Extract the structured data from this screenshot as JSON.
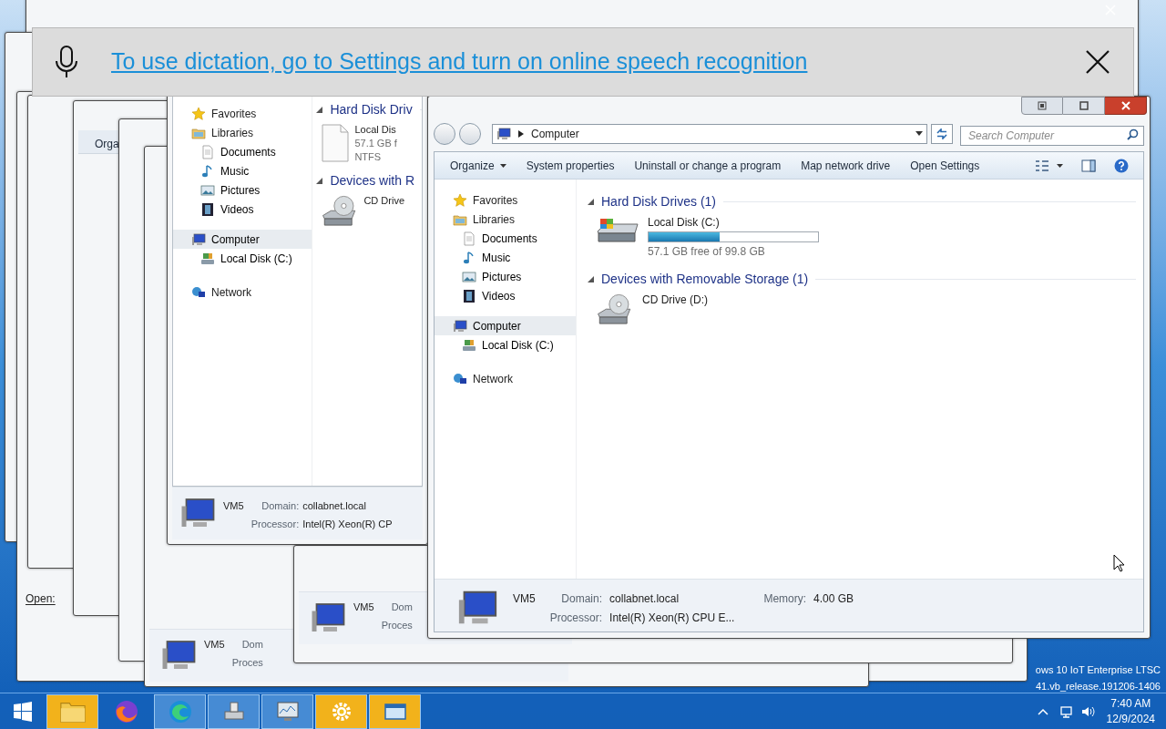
{
  "banner": {
    "message": "To use dictation, go to Settings and turn on online speech recognition"
  },
  "background_windows": {
    "toolbar_fragment": "Orga",
    "open_label": "Open:",
    "footers": [
      {
        "computer": "VM5",
        "field_1": "Dom",
        "field_2": "Proces"
      },
      {
        "computer": "VM5",
        "field_1": "Dom",
        "field_2": "Proces"
      }
    ]
  },
  "back_explorer": {
    "nav": [
      {
        "kind": "star",
        "label": "Favorites",
        "selected": false
      },
      {
        "kind": "library",
        "label": "Libraries",
        "selected": false,
        "children": [
          {
            "kind": "document",
            "label": "Documents",
            "selected": false
          },
          {
            "kind": "music",
            "label": "Music",
            "selected": false
          },
          {
            "kind": "picture",
            "label": "Pictures",
            "selected": false
          },
          {
            "kind": "video",
            "label": "Videos",
            "selected": false
          }
        ]
      },
      {
        "kind": "computer",
        "label": "Computer",
        "selected": true,
        "children": [
          {
            "kind": "disk",
            "label": "Local Disk (C:)",
            "selected": false
          }
        ]
      },
      {
        "kind": "network",
        "label": "Network",
        "selected": false
      }
    ],
    "groups": [
      {
        "title": "Hard Disk Driv",
        "items": [
          {
            "kind": "file",
            "name": "Local Dis",
            "lines": [
              "57.1 GB f",
              "NTFS"
            ]
          }
        ]
      },
      {
        "title": "Devices with R",
        "items": [
          {
            "kind": "cd",
            "name": "CD Drive"
          }
        ]
      }
    ],
    "footer": {
      "computer": "VM5",
      "rows": [
        [
          {
            "label": "Domain:",
            "value": "collabnet.local"
          }
        ],
        [
          {
            "label": "Processor:",
            "value": "Intel(R) Xeon(R) CP"
          }
        ]
      ]
    }
  },
  "main_window": {
    "address": "Computer",
    "search": {
      "placeholder": "Search Computer"
    },
    "toolbar": [
      {
        "label": "Organize",
        "menu": true
      },
      {
        "label": "System properties",
        "menu": false
      },
      {
        "label": "Uninstall or change a program",
        "menu": false
      },
      {
        "label": "Map network drive",
        "menu": false
      },
      {
        "label": "Open Settings",
        "menu": false
      }
    ],
    "nav": [
      {
        "kind": "star",
        "label": "Favorites",
        "selected": false
      },
      {
        "kind": "library",
        "label": "Libraries",
        "selected": false,
        "children": [
          {
            "kind": "document",
            "label": "Documents",
            "selected": false
          },
          {
            "kind": "music",
            "label": "Music",
            "selected": false
          },
          {
            "kind": "picture",
            "label": "Pictures",
            "selected": false
          },
          {
            "kind": "video",
            "label": "Videos",
            "selected": false
          }
        ]
      },
      {
        "kind": "computer",
        "label": "Computer",
        "selected": true,
        "children": [
          {
            "kind": "disk",
            "label": "Local Disk (C:)",
            "selected": false
          }
        ]
      },
      {
        "kind": "network",
        "label": "Network",
        "selected": false
      }
    ],
    "groups": [
      {
        "title": "Hard Disk Drives (1)",
        "items": [
          {
            "kind": "hdd",
            "name": "Local Disk (C:)",
            "level": 0.42,
            "detail": "57.1 GB free of 99.8 GB"
          }
        ]
      },
      {
        "title": "Devices with Removable Storage (1)",
        "items": [
          {
            "kind": "cd",
            "name": "CD Drive (D:)"
          }
        ]
      }
    ],
    "footer": {
      "computer": "VM5",
      "rows": [
        [
          {
            "label": "Domain:",
            "value": "collabnet.local"
          },
          {
            "label": "Memory:",
            "value": "4.00 GB"
          }
        ],
        [
          {
            "label": "Processor:",
            "value": "Intel(R) Xeon(R) CPU E..."
          }
        ]
      ]
    }
  },
  "desktop_text": [
    "ows 10 IoT Enterprise LTSC",
    "41.vb_release.191206-1406"
  ],
  "taskbar": {
    "items": [
      {
        "kind": "folder",
        "open": true,
        "flashing": true
      },
      {
        "kind": "firefox",
        "open": false,
        "flashing": false
      },
      {
        "kind": "edge",
        "open": true,
        "flashing": false
      },
      {
        "kind": "app",
        "open": true,
        "flashing": false
      },
      {
        "kind": "monitor",
        "open": true,
        "flashing": false
      },
      {
        "kind": "gear",
        "open": true,
        "flashing": true
      },
      {
        "kind": "window",
        "open": true,
        "flashing": true
      }
    ],
    "time": "7:40 AM",
    "date": "12/9/2024"
  }
}
